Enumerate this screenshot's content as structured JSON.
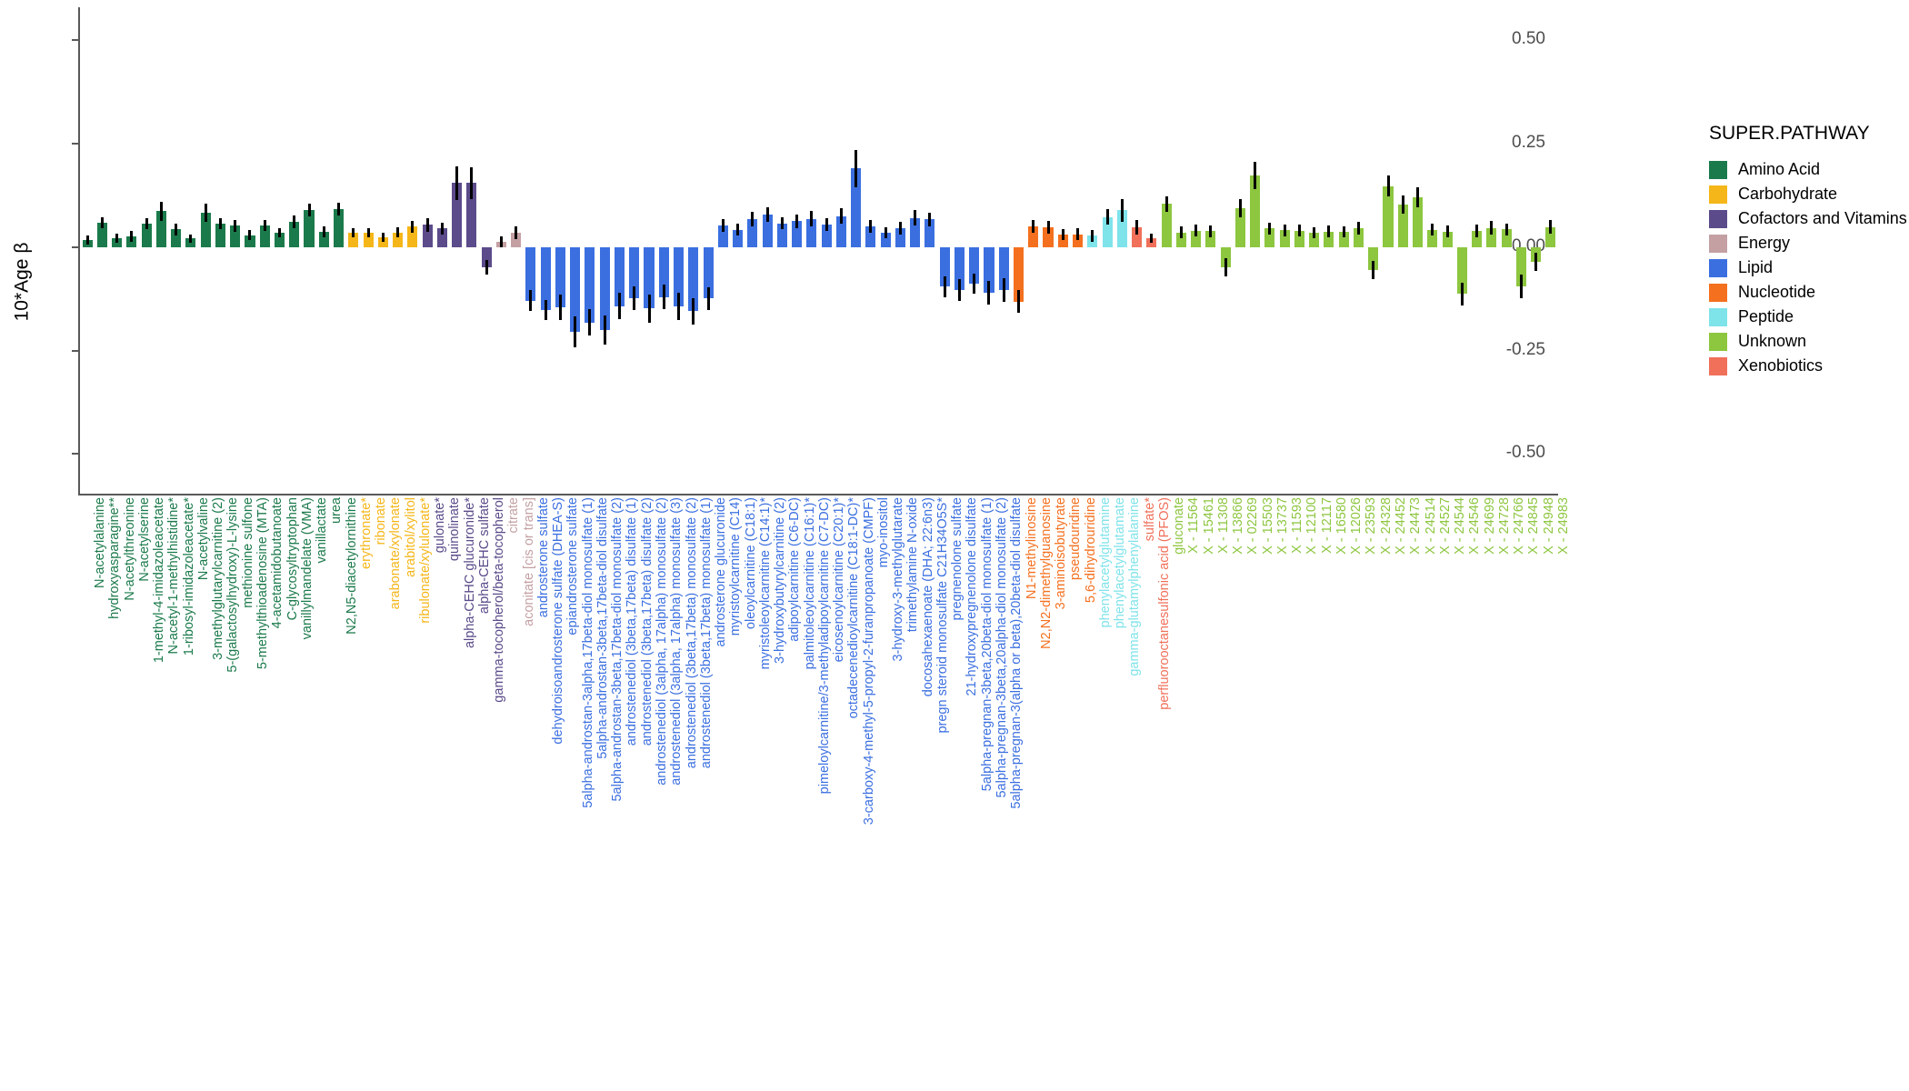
{
  "chart_data": {
    "type": "bar",
    "title": "",
    "xlabel": "",
    "ylabel": "10*Age β",
    "ylim": [
      -0.6,
      0.58
    ],
    "yticks": [
      "0.50",
      "0.25",
      "0.00",
      "-0.25",
      "-0.50"
    ],
    "ytick_values": [
      0.5,
      0.25,
      0.0,
      -0.25,
      -0.5
    ],
    "grid": false,
    "legend_position": "right",
    "legend_title": "SUPER.PATHWAY",
    "legend": [
      {
        "label": "Amino Acid",
        "color": "#1b7a4b"
      },
      {
        "label": "Carbohydrate",
        "color": "#f5b619"
      },
      {
        "label": "Cofactors and Vitamins",
        "color": "#5b4b8a"
      },
      {
        "label": "Energy",
        "color": "#c4a0a3"
      },
      {
        "label": "Lipid",
        "color": "#3b6fe0"
      },
      {
        "label": "Nucleotide",
        "color": "#f4701f"
      },
      {
        "label": "Peptide",
        "color": "#7fe3ea"
      },
      {
        "label": "Unknown",
        "color": "#8dc63f"
      },
      {
        "label": "Xenobiotics",
        "color": "#f0705a"
      }
    ],
    "errorbar_color": "#000000",
    "categories": [
      "N-acetylalanine",
      "hydroxyasparagine**",
      "N-acetylthreonine",
      "N-acetylserine",
      "1-methyl-4-imidazoleacetate",
      "N-acetyl-1-methylhistidine*",
      "1-ribosyl-imidazoleacetate*",
      "N-acetylvaline",
      "3-methylglutarylcarnitine (2)",
      "5-(galactosylhydroxy)-L-lysine",
      "methionine sulfone",
      "5-methylthioadenosine (MTA)",
      "4-acetamidobutanoate",
      "C-glycosyltryptophan",
      "vanillylmandelate (VMA)",
      "vanillactate",
      "urea",
      "N2,N5-diacetylornithine",
      "erythronate*",
      "ribonate",
      "arabonate/xylonate",
      "arabitol/xylitol",
      "ribulonate/xylulonate*",
      "gulonate*",
      "quinolinate",
      "alpha-CEHC glucuronide*",
      "alpha-CEHC sulfate",
      "gamma-tocopherol/beta-tocopherol",
      "citrate",
      "aconitate [cis or trans]",
      "androsterone sulfate",
      "dehydroisoandrosterone sulfate (DHEA-S)",
      "epiandrosterone sulfate",
      "5alpha-androstan-3alpha,17beta-diol monosulfate (1)",
      "5alpha-androstan-3beta,17beta-diol disulfate",
      "5alpha-androstan-3beta,17beta-diol monosulfate (2)",
      "androstenediol (3beta,17beta) disulfate (1)",
      "androstenediol (3beta,17beta) disulfate (2)",
      "androstenediol (3alpha, 17alpha) monosulfate (2)",
      "androstenediol (3alpha, 17alpha) monosulfate (3)",
      "androstenediol (3beta,17beta) monosulfate (2)",
      "androstenediol (3beta,17beta) monosulfate (1)",
      "androsterone glucuronide",
      "myristoylcarnitine (C14)",
      "oleoylcarnitine (C18:1)",
      "myristoleoylcarnitine (C14:1)*",
      "3-hydroxybutyrylcarnitine (2)",
      "adipoylcarnitine (C6-DC)",
      "palmitoleoylcarnitine (C16:1)*",
      "pimeloylcarnitine/3-methyladipoylcarnitine (C7-DC)",
      "eicosenoylcarnitine (C20:1)*",
      "octadecenedioylcarnitine (C18:1-DC)*",
      "3-carboxy-4-methyl-5-propyl-2-furanpropanoate (CMPF)",
      "myo-inositol",
      "3-hydroxy-3-methylglutarate",
      "trimethylamine N-oxide",
      "docosahexaenoate (DHA; 22:6n3)",
      "pregn steroid monosulfate C21H34O5S*",
      "pregnenolone sulfate",
      "21-hydroxypregnenolone disulfate",
      "5alpha-pregnan-3beta,20beta-diol monosulfate (1)",
      "5alpha-pregnan-3beta,20alpha-diol monosulfate (2)",
      "5alpha-pregnan-3(alpha or beta),20beta-diol disulfate",
      "N1-methylinosine",
      "N2,N2-dimethylguanosine",
      "3-aminoisobutyrate",
      "pseudouridine",
      "5,6-dihydrouridine",
      "phenylacetylglutamine",
      "phenylacetylglutamate",
      "gamma-glutamylphenylalanine",
      "sulfate*",
      "perfluorooctanesulfonic acid (PFOS)",
      "gluconate",
      "X - 11564",
      "X - 15461",
      "X - 11308",
      "X - 13866",
      "X - 02269",
      "X - 15503",
      "X - 13737",
      "X - 11593",
      "X - 12100",
      "X - 12117",
      "X - 16580",
      "X - 12026",
      "X - 23593",
      "X - 24328",
      "X - 24452",
      "X - 24473",
      "X - 24514",
      "X - 24527",
      "X - 24544",
      "X - 24546",
      "X - 24699",
      "X - 24728",
      "X - 24766",
      "X - 24845",
      "X - 24948",
      "X - 24983"
    ],
    "groups": [
      "Amino Acid",
      "Amino Acid",
      "Amino Acid",
      "Amino Acid",
      "Amino Acid",
      "Amino Acid",
      "Amino Acid",
      "Amino Acid",
      "Amino Acid",
      "Amino Acid",
      "Amino Acid",
      "Amino Acid",
      "Amino Acid",
      "Amino Acid",
      "Amino Acid",
      "Amino Acid",
      "Amino Acid",
      "Amino Acid",
      "Carbohydrate",
      "Carbohydrate",
      "Carbohydrate",
      "Carbohydrate",
      "Carbohydrate",
      "Cofactors and Vitamins",
      "Cofactors and Vitamins",
      "Cofactors and Vitamins",
      "Cofactors and Vitamins",
      "Cofactors and Vitamins",
      "Energy",
      "Energy",
      "Lipid",
      "Lipid",
      "Lipid",
      "Lipid",
      "Lipid",
      "Lipid",
      "Lipid",
      "Lipid",
      "Lipid",
      "Lipid",
      "Lipid",
      "Lipid",
      "Lipid",
      "Lipid",
      "Lipid",
      "Lipid",
      "Lipid",
      "Lipid",
      "Lipid",
      "Lipid",
      "Lipid",
      "Lipid",
      "Lipid",
      "Lipid",
      "Lipid",
      "Lipid",
      "Lipid",
      "Lipid",
      "Lipid",
      "Lipid",
      "Lipid",
      "Lipid",
      "Lipid",
      "Nucleotide",
      "Nucleotide",
      "Nucleotide",
      "Nucleotide",
      "Nucleotide",
      "Peptide",
      "Peptide",
      "Peptide",
      "Xenobiotics",
      "Xenobiotics",
      "Unknown",
      "Unknown",
      "Unknown",
      "Unknown",
      "Unknown",
      "Unknown",
      "Unknown",
      "Unknown",
      "Unknown",
      "Unknown",
      "Unknown",
      "Unknown",
      "Unknown",
      "Unknown",
      "Unknown",
      "Unknown",
      "Unknown",
      "Unknown",
      "Unknown",
      "Unknown",
      "Unknown",
      "Unknown",
      "Unknown",
      "Unknown",
      "Unknown",
      "Unknown",
      "Unknown"
    ],
    "values": [
      0.018,
      0.06,
      0.022,
      0.027,
      0.057,
      0.087,
      0.043,
      0.021,
      0.084,
      0.057,
      0.052,
      0.029,
      0.053,
      0.035,
      0.062,
      0.09,
      0.038,
      0.092,
      0.035,
      0.035,
      0.025,
      0.036,
      0.05,
      0.054,
      0.045,
      0.155,
      0.155,
      -0.048,
      0.013,
      0.035,
      -0.129,
      -0.152,
      -0.145,
      -0.205,
      -0.182,
      -0.2,
      -0.142,
      -0.123,
      -0.148,
      -0.12,
      -0.144,
      -0.155,
      -0.124,
      0.053,
      0.042,
      0.068,
      0.079,
      0.058,
      0.063,
      0.069,
      0.055,
      0.075,
      0.19,
      0.051,
      0.035,
      0.046,
      0.071,
      0.067,
      -0.095,
      -0.103,
      -0.088,
      -0.11,
      -0.103,
      -0.131,
      0.05,
      0.048,
      0.03,
      0.031,
      0.028,
      0.073,
      0.089,
      0.048,
      0.022,
      0.105,
      0.036,
      0.04,
      0.039,
      -0.049,
      0.095,
      0.173,
      0.045,
      0.041,
      0.04,
      0.035,
      0.038,
      0.037,
      0.046,
      -0.055,
      0.148,
      0.104,
      0.12,
      0.042,
      0.038,
      -0.113,
      0.04,
      0.047,
      0.043,
      -0.095,
      -0.035,
      0.049
    ],
    "errors_upper": [
      0.029,
      0.073,
      0.033,
      0.04,
      0.07,
      0.11,
      0.057,
      0.031,
      0.106,
      0.071,
      0.066,
      0.041,
      0.066,
      0.047,
      0.077,
      0.106,
      0.051,
      0.107,
      0.047,
      0.047,
      0.036,
      0.049,
      0.064,
      0.07,
      0.06,
      0.195,
      0.194,
      -0.03,
      0.026,
      0.051,
      -0.103,
      -0.127,
      -0.114,
      -0.168,
      -0.15,
      -0.164,
      -0.111,
      -0.094,
      -0.114,
      -0.09,
      -0.111,
      -0.123,
      -0.097,
      0.068,
      0.056,
      0.085,
      0.097,
      0.073,
      0.079,
      0.087,
      0.07,
      0.094,
      0.236,
      0.066,
      0.049,
      0.062,
      0.09,
      0.084,
      -0.07,
      -0.077,
      -0.063,
      -0.082,
      -0.075,
      -0.103,
      0.065,
      0.063,
      0.043,
      0.045,
      0.042,
      0.092,
      0.117,
      0.065,
      0.033,
      0.124,
      0.05,
      0.054,
      0.053,
      -0.027,
      0.117,
      0.206,
      0.06,
      0.055,
      0.054,
      0.048,
      0.052,
      0.051,
      0.061,
      -0.032,
      0.173,
      0.126,
      0.144,
      0.056,
      0.053,
      -0.085,
      0.055,
      0.063,
      0.058,
      -0.067,
      -0.013,
      0.065
    ],
    "errors_lower": [
      0.007,
      0.047,
      0.011,
      0.014,
      0.044,
      0.064,
      0.029,
      0.011,
      0.062,
      0.043,
      0.038,
      0.017,
      0.04,
      0.023,
      0.047,
      0.074,
      0.025,
      0.077,
      0.023,
      0.023,
      0.014,
      0.023,
      0.036,
      0.038,
      0.03,
      0.115,
      0.116,
      -0.066,
      0.0,
      0.019,
      -0.155,
      -0.177,
      -0.176,
      -0.242,
      -0.214,
      -0.236,
      -0.173,
      -0.152,
      -0.182,
      -0.15,
      -0.177,
      -0.187,
      -0.151,
      0.038,
      0.028,
      0.051,
      0.061,
      0.043,
      0.047,
      0.051,
      0.04,
      0.056,
      0.144,
      0.036,
      0.021,
      0.03,
      0.052,
      0.05,
      -0.12,
      -0.129,
      -0.113,
      -0.138,
      -0.131,
      -0.159,
      0.035,
      0.033,
      0.017,
      0.017,
      0.014,
      0.054,
      0.061,
      0.031,
      0.011,
      0.086,
      0.022,
      0.026,
      0.025,
      -0.071,
      0.073,
      0.14,
      0.03,
      0.027,
      0.026,
      0.022,
      0.024,
      0.023,
      0.031,
      -0.078,
      0.123,
      0.082,
      0.096,
      0.028,
      0.023,
      -0.141,
      0.025,
      0.031,
      0.028,
      -0.123,
      -0.057,
      0.033
    ]
  }
}
